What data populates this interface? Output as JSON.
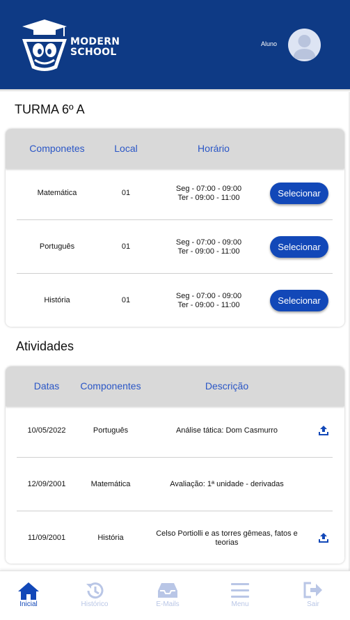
{
  "header": {
    "brand_line1": "MODERN",
    "brand_line2": "SCHOOL",
    "user_role": "Aluno"
  },
  "classes": {
    "title": "TURMA 6º A",
    "columns": [
      "Componetes",
      "Local",
      "Horário"
    ],
    "select_label": "Selecionar",
    "rows": [
      {
        "component": "Matemática",
        "local": "01",
        "schedule_1": "Seg - 07:00 - 09:00",
        "schedule_2": "Ter - 09:00 - 11:00"
      },
      {
        "component": "Português",
        "local": "01",
        "schedule_1": "Seg - 07:00 - 09:00",
        "schedule_2": "Ter - 09:00 - 11:00"
      },
      {
        "component": "História",
        "local": "01",
        "schedule_1": "Seg - 07:00 - 09:00",
        "schedule_2": "Ter - 09:00 - 11:00"
      }
    ]
  },
  "activities": {
    "title": "Atividades",
    "columns": [
      "Datas",
      "Componentes",
      "Descrição"
    ],
    "rows": [
      {
        "date": "10/05/2022",
        "component": "Português",
        "description": "Análise tática: Dom Casmurro",
        "has_upload": true
      },
      {
        "date": "12/09/2001",
        "component": "Matemática",
        "description": "Avaliação: 1ª unidade - derivadas",
        "has_upload": false
      },
      {
        "date": "11/09/2001",
        "component": "História",
        "description": "Celso Portiolli e as torres gêmeas, fatos e teorias",
        "has_upload": true
      }
    ]
  },
  "bottom_nav": {
    "items": [
      {
        "label": "Inicial",
        "icon": "home-icon",
        "active": true
      },
      {
        "label": "Histórico",
        "icon": "history-icon",
        "active": false
      },
      {
        "label": "E-Mails",
        "icon": "inbox-icon",
        "active": false
      },
      {
        "label": "Menu",
        "icon": "menu-icon",
        "active": false
      },
      {
        "label": "Sair",
        "icon": "logout-icon",
        "active": false
      }
    ]
  },
  "colors": {
    "header_bg": "#0e3a85",
    "accent": "#1248b8",
    "header_text_blue": "#2a56c6",
    "table_header_bg": "#d9d9d9",
    "nav_inactive": "#b9c6e6"
  }
}
